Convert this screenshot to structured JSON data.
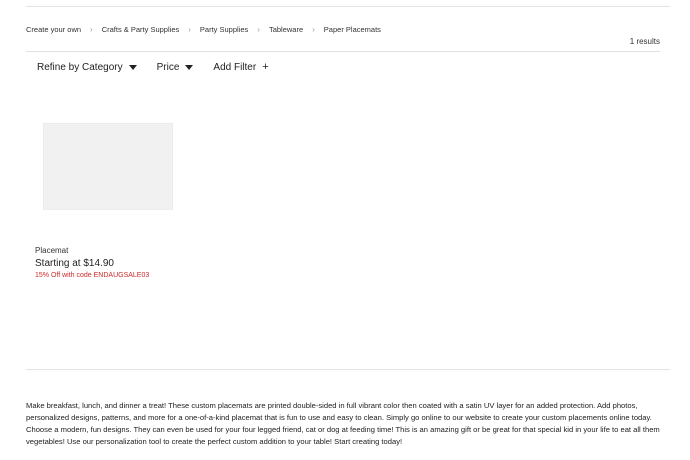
{
  "breadcrumb": {
    "items": [
      "Create your own",
      "Crafts & Party Supplies",
      "Party Supplies",
      "Tableware",
      "Paper Placemats"
    ],
    "separator": "›"
  },
  "results": {
    "count_label": "1 results"
  },
  "filters": {
    "category_label": "Refine by Category",
    "price_label": "Price",
    "add_label": "Add Filter",
    "add_symbol": "+"
  },
  "product": {
    "title": "Placemat",
    "price": "Starting at $14.90",
    "promo": "15% Off with code ENDAUGSALE03"
  },
  "colors": {
    "promo": "#cc2a2a",
    "text": "#222222",
    "divider": "#e4e4e4"
  },
  "description": "Make breakfast, lunch, and dinner a treat! These custom placemats are printed double-sided in full vibrant color then coated with a satin UV layer for an added protection. Add photos, personalized designs, patterns, and more for a one-of-a-kind placemat that is fun to use and easy to clean. Simply go online to our website to create your custom placements online today. Choose a modern, fun designs. They can even be used for your four legged friend, cat or dog at feeding time! This is an amazing gift or be great for that special kid in your life to eat all them vegetables! Use our personalization tool to create the perfect custom addition to your table! Start creating today!"
}
